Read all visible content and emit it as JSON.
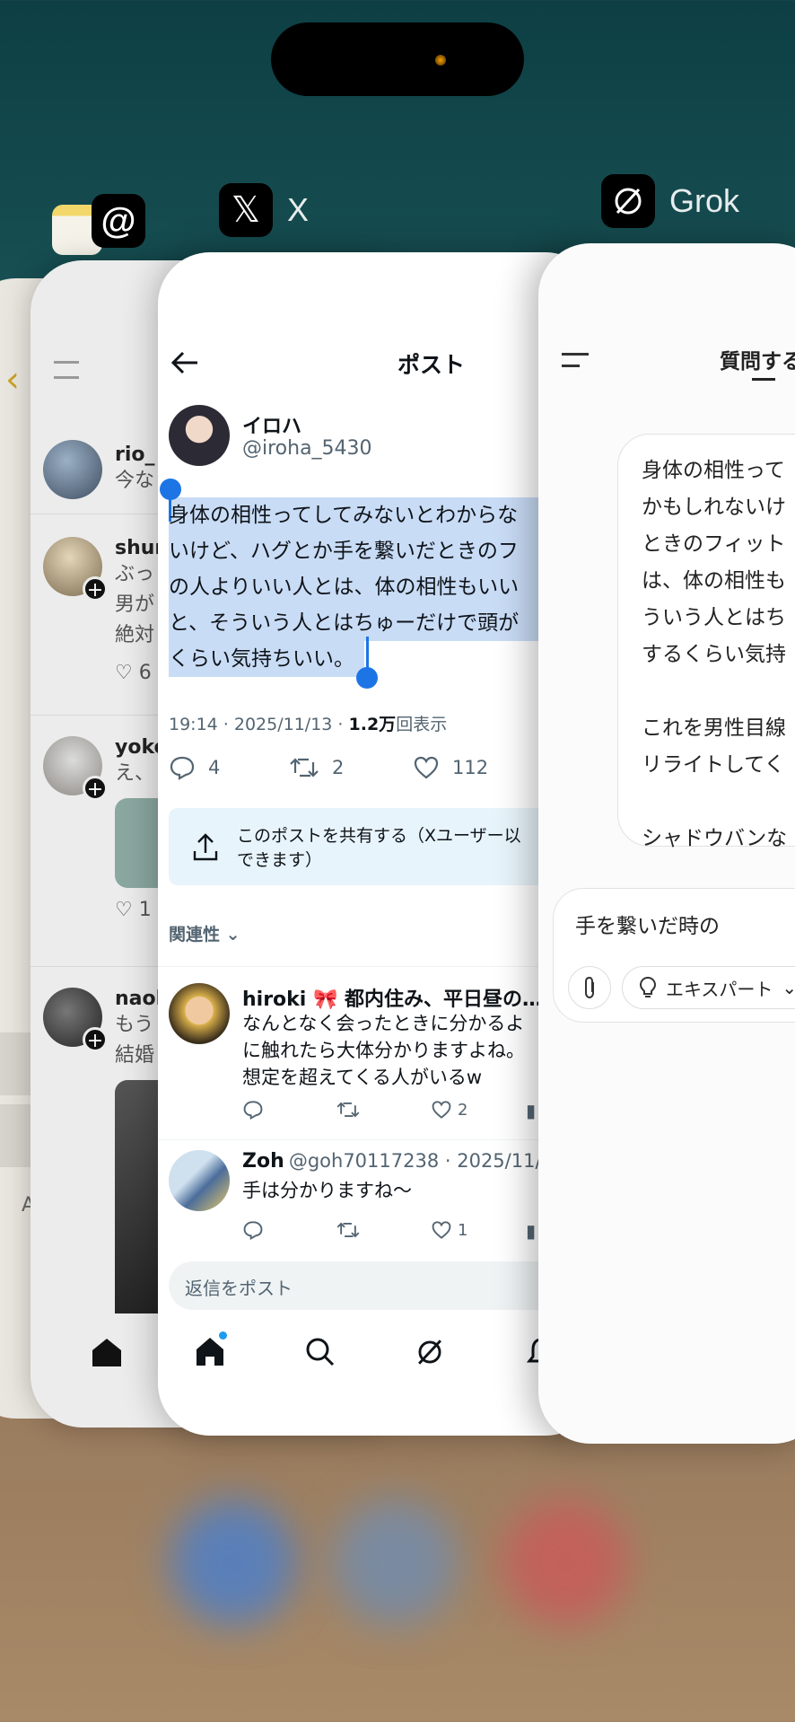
{
  "apps": {
    "threads_name": "",
    "x_name": "X",
    "grok_name": "Grok"
  },
  "threads": {
    "rows": [
      {
        "name": "rio_",
        "text": "今な"
      },
      {
        "name": "shur",
        "text1": "ぶっ",
        "text2": "男が",
        "text3": "絶対",
        "likes": "6"
      },
      {
        "name": "yoko",
        "text1": "え、",
        "likes": "1"
      },
      {
        "name": "naol",
        "text1": "もう",
        "text2": "結婚"
      }
    ],
    "side_letter": "A"
  },
  "x": {
    "header_title": "ポスト",
    "author_name": "イロハ",
    "author_handle": "@iroha_5430",
    "post_lines": [
      "身体の相性ってしてみないとわからな",
      "いけど、ハグとか手を繋いだときのフ",
      "の人よりいい人とは、体の相性もいい",
      "と、そういう人とはちゅーだけで頭が",
      "くらい気持ちいい。"
    ],
    "meta_time": "19:14 · 2025/11/13 · ",
    "meta_views_num": "1.2万",
    "meta_views_label": "回表示",
    "replies": "4",
    "reposts": "2",
    "likes": "112",
    "share_line1": "このポストを共有する（Xユーザー以",
    "share_line2": "できます）",
    "sort_label": "関連性",
    "reply_items": [
      {
        "name": "hiroki 🎀 都内住み、平日昼の…",
        "lines": [
          "なんとなく会ったときに分かるよ",
          "に触れたら大体分かりますよね。",
          "想定を超えてくる人がいるw"
        ],
        "likes": "2"
      },
      {
        "name": "Zoh",
        "handle": "@goh70117238 · 2025/11/1",
        "lines": [
          "手は分かりますね〜"
        ],
        "likes": "1"
      }
    ],
    "reply_placeholder": "返信をポスト"
  },
  "grok": {
    "header_title": "質問する",
    "bubble_lines": [
      "身体の相性って",
      "かもしれないけ",
      "ときのフィット",
      "は、体の相性も",
      "ういう人とはち",
      "するくらい気持",
      "",
      "これを男性目線",
      "リライトしてく",
      "",
      "シャドウバンな"
    ],
    "input_value": "手を繋いだ時の",
    "mode_label": "エキスパート"
  }
}
